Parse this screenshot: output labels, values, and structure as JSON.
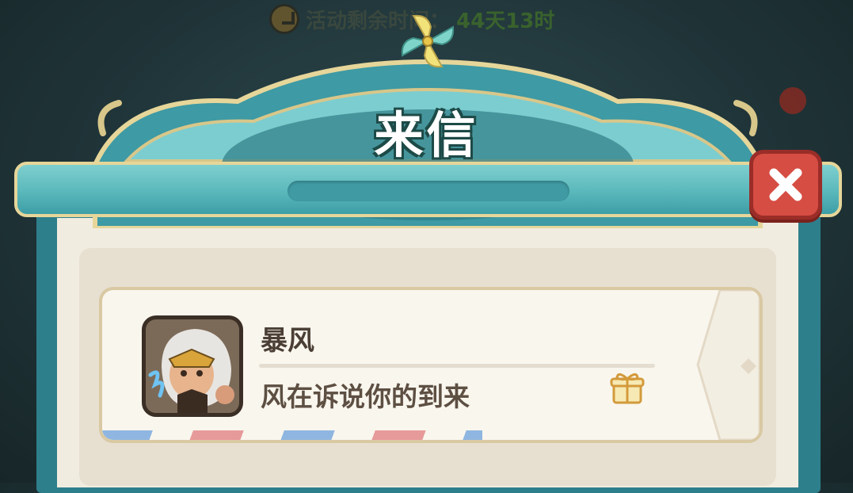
{
  "background": {
    "timer_label": "活动剩余时间：",
    "timer_value": "44天13时"
  },
  "dialog": {
    "title": "来信",
    "close_icon": "close-x-icon"
  },
  "letters": [
    {
      "sender": "暴风",
      "message": "风在诉说你的到来",
      "avatar_icon": "storm-hero-avatar",
      "attachment_icon": "gift-icon"
    }
  ],
  "colors": {
    "frame_teal": "#2e7f8c",
    "header_teal": "#5ab8bb",
    "gold_trim": "#e6d69a",
    "paper": "#f9f6ee",
    "close_red": "#d64d43",
    "text_brown": "#4b3f35"
  }
}
